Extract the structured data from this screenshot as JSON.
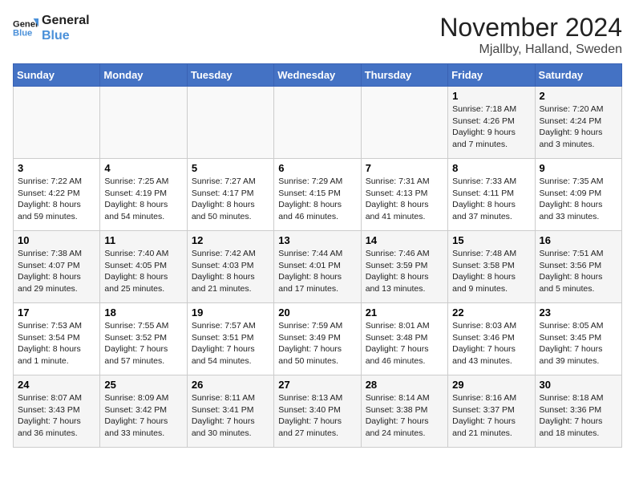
{
  "header": {
    "logo_line1": "General",
    "logo_line2": "Blue",
    "month_title": "November 2024",
    "location": "Mjallby, Halland, Sweden"
  },
  "weekdays": [
    "Sunday",
    "Monday",
    "Tuesday",
    "Wednesday",
    "Thursday",
    "Friday",
    "Saturday"
  ],
  "weeks": [
    [
      {
        "day": "",
        "info": ""
      },
      {
        "day": "",
        "info": ""
      },
      {
        "day": "",
        "info": ""
      },
      {
        "day": "",
        "info": ""
      },
      {
        "day": "",
        "info": ""
      },
      {
        "day": "1",
        "info": "Sunrise: 7:18 AM\nSunset: 4:26 PM\nDaylight: 9 hours\nand 7 minutes."
      },
      {
        "day": "2",
        "info": "Sunrise: 7:20 AM\nSunset: 4:24 PM\nDaylight: 9 hours\nand 3 minutes."
      }
    ],
    [
      {
        "day": "3",
        "info": "Sunrise: 7:22 AM\nSunset: 4:22 PM\nDaylight: 8 hours\nand 59 minutes."
      },
      {
        "day": "4",
        "info": "Sunrise: 7:25 AM\nSunset: 4:19 PM\nDaylight: 8 hours\nand 54 minutes."
      },
      {
        "day": "5",
        "info": "Sunrise: 7:27 AM\nSunset: 4:17 PM\nDaylight: 8 hours\nand 50 minutes."
      },
      {
        "day": "6",
        "info": "Sunrise: 7:29 AM\nSunset: 4:15 PM\nDaylight: 8 hours\nand 46 minutes."
      },
      {
        "day": "7",
        "info": "Sunrise: 7:31 AM\nSunset: 4:13 PM\nDaylight: 8 hours\nand 41 minutes."
      },
      {
        "day": "8",
        "info": "Sunrise: 7:33 AM\nSunset: 4:11 PM\nDaylight: 8 hours\nand 37 minutes."
      },
      {
        "day": "9",
        "info": "Sunrise: 7:35 AM\nSunset: 4:09 PM\nDaylight: 8 hours\nand 33 minutes."
      }
    ],
    [
      {
        "day": "10",
        "info": "Sunrise: 7:38 AM\nSunset: 4:07 PM\nDaylight: 8 hours\nand 29 minutes."
      },
      {
        "day": "11",
        "info": "Sunrise: 7:40 AM\nSunset: 4:05 PM\nDaylight: 8 hours\nand 25 minutes."
      },
      {
        "day": "12",
        "info": "Sunrise: 7:42 AM\nSunset: 4:03 PM\nDaylight: 8 hours\nand 21 minutes."
      },
      {
        "day": "13",
        "info": "Sunrise: 7:44 AM\nSunset: 4:01 PM\nDaylight: 8 hours\nand 17 minutes."
      },
      {
        "day": "14",
        "info": "Sunrise: 7:46 AM\nSunset: 3:59 PM\nDaylight: 8 hours\nand 13 minutes."
      },
      {
        "day": "15",
        "info": "Sunrise: 7:48 AM\nSunset: 3:58 PM\nDaylight: 8 hours\nand 9 minutes."
      },
      {
        "day": "16",
        "info": "Sunrise: 7:51 AM\nSunset: 3:56 PM\nDaylight: 8 hours\nand 5 minutes."
      }
    ],
    [
      {
        "day": "17",
        "info": "Sunrise: 7:53 AM\nSunset: 3:54 PM\nDaylight: 8 hours\nand 1 minute."
      },
      {
        "day": "18",
        "info": "Sunrise: 7:55 AM\nSunset: 3:52 PM\nDaylight: 7 hours\nand 57 minutes."
      },
      {
        "day": "19",
        "info": "Sunrise: 7:57 AM\nSunset: 3:51 PM\nDaylight: 7 hours\nand 54 minutes."
      },
      {
        "day": "20",
        "info": "Sunrise: 7:59 AM\nSunset: 3:49 PM\nDaylight: 7 hours\nand 50 minutes."
      },
      {
        "day": "21",
        "info": "Sunrise: 8:01 AM\nSunset: 3:48 PM\nDaylight: 7 hours\nand 46 minutes."
      },
      {
        "day": "22",
        "info": "Sunrise: 8:03 AM\nSunset: 3:46 PM\nDaylight: 7 hours\nand 43 minutes."
      },
      {
        "day": "23",
        "info": "Sunrise: 8:05 AM\nSunset: 3:45 PM\nDaylight: 7 hours\nand 39 minutes."
      }
    ],
    [
      {
        "day": "24",
        "info": "Sunrise: 8:07 AM\nSunset: 3:43 PM\nDaylight: 7 hours\nand 36 minutes."
      },
      {
        "day": "25",
        "info": "Sunrise: 8:09 AM\nSunset: 3:42 PM\nDaylight: 7 hours\nand 33 minutes."
      },
      {
        "day": "26",
        "info": "Sunrise: 8:11 AM\nSunset: 3:41 PM\nDaylight: 7 hours\nand 30 minutes."
      },
      {
        "day": "27",
        "info": "Sunrise: 8:13 AM\nSunset: 3:40 PM\nDaylight: 7 hours\nand 27 minutes."
      },
      {
        "day": "28",
        "info": "Sunrise: 8:14 AM\nSunset: 3:38 PM\nDaylight: 7 hours\nand 24 minutes."
      },
      {
        "day": "29",
        "info": "Sunrise: 8:16 AM\nSunset: 3:37 PM\nDaylight: 7 hours\nand 21 minutes."
      },
      {
        "day": "30",
        "info": "Sunrise: 8:18 AM\nSunset: 3:36 PM\nDaylight: 7 hours\nand 18 minutes."
      }
    ]
  ]
}
